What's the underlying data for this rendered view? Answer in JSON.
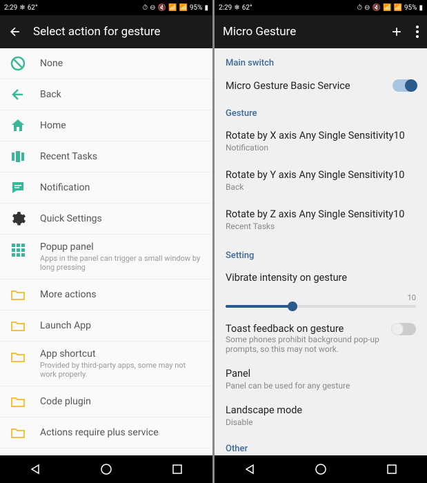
{
  "status": {
    "time": "2:29",
    "temp": "62°",
    "battery": "95%"
  },
  "left": {
    "title": "Select action for gesture",
    "items": [
      {
        "key": "none",
        "label": "None",
        "icon": "none"
      },
      {
        "key": "back",
        "label": "Back",
        "icon": "back"
      },
      {
        "key": "home",
        "label": "Home",
        "icon": "home"
      },
      {
        "key": "recent",
        "label": "Recent Tasks",
        "icon": "recent"
      },
      {
        "key": "notification",
        "label": "Notification",
        "icon": "notification"
      },
      {
        "key": "quicksettings",
        "label": "Quick Settings",
        "icon": "settings"
      },
      {
        "key": "popup",
        "label": "Popup panel",
        "sub": "Apps in the panel can trigger a small window by long pressing",
        "icon": "grid"
      },
      {
        "key": "moreactions",
        "label": "More actions",
        "icon": "folder"
      },
      {
        "key": "launchapp",
        "label": "Launch App",
        "icon": "folder"
      },
      {
        "key": "appshortcut",
        "label": "App shortcut",
        "sub": "Provided by third-party apps, some may not work properly.",
        "icon": "folder"
      },
      {
        "key": "codeplugin",
        "label": "Code plugin",
        "icon": "folder"
      },
      {
        "key": "plus",
        "label": "Actions require plus service",
        "icon": "folder"
      }
    ]
  },
  "right": {
    "title": "Micro Gesture",
    "sections": {
      "mainswitch": {
        "header": "Main switch",
        "service": {
          "label": "Micro Gesture Basic Service",
          "on": true
        }
      },
      "gesture": {
        "header": "Gesture",
        "items": [
          {
            "title": "Rotate by X axis Any Single Sensitivity10",
            "sub": "Notification"
          },
          {
            "title": "Rotate by Y axis Any Single Sensitivity10",
            "sub": "Back"
          },
          {
            "title": "Rotate by Z axis Any Single Sensitivity10",
            "sub": "Recent Tasks"
          }
        ]
      },
      "setting": {
        "header": "Setting",
        "vibrate": {
          "label": "Vibrate intensity on gesture",
          "value": "10"
        },
        "toast": {
          "label": "Toast feedback on gesture",
          "sub": "Some phones prohibit background pop-up prompts, so this may not work.",
          "on": false
        },
        "panel": {
          "label": "Panel",
          "sub": "Panel can be used for any gesture"
        },
        "landscape": {
          "label": "Landscape mode",
          "sub": "Disable"
        }
      },
      "other": {
        "header": "Other"
      }
    }
  },
  "colors": {
    "teal": "#3ab79a",
    "yellow": "#f4c13a",
    "accent": "#3b6a99"
  }
}
